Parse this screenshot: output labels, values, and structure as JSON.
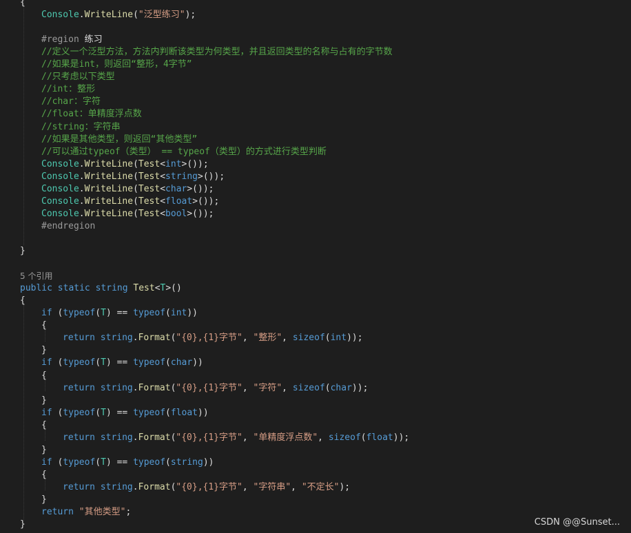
{
  "code": {
    "lines": [
      {
        "indent": 0,
        "tokens": [
          {
            "t": "{",
            "c": "pl"
          }
        ]
      },
      {
        "indent": 1,
        "tokens": [
          {
            "t": "Console",
            "c": "ty"
          },
          {
            "t": ".",
            "c": "pl"
          },
          {
            "t": "WriteLine",
            "c": "fn"
          },
          {
            "t": "(",
            "c": "pl"
          },
          {
            "t": "\"泛型练习\"",
            "c": "str"
          },
          {
            "t": ");",
            "c": "pl"
          }
        ]
      },
      {
        "indent": 0,
        "tokens": []
      },
      {
        "indent": 1,
        "tokens": [
          {
            "t": "#region ",
            "c": "pp"
          },
          {
            "t": "练习",
            "c": "pl"
          }
        ]
      },
      {
        "indent": 1,
        "tokens": [
          {
            "t": "//定义一个泛型方法，方法内判断该类型为何类型，并且返回类型的名称与占有的字节数",
            "c": "cm"
          }
        ]
      },
      {
        "indent": 1,
        "tokens": [
          {
            "t": "//如果是int，则返回“整形，4字节”",
            "c": "cm"
          }
        ]
      },
      {
        "indent": 1,
        "tokens": [
          {
            "t": "//只考虑以下类型",
            "c": "cm"
          }
        ]
      },
      {
        "indent": 1,
        "tokens": [
          {
            "t": "//int：整形",
            "c": "cm"
          }
        ]
      },
      {
        "indent": 1,
        "tokens": [
          {
            "t": "//char：字符",
            "c": "cm"
          }
        ]
      },
      {
        "indent": 1,
        "tokens": [
          {
            "t": "//float：单精度浮点数",
            "c": "cm"
          }
        ]
      },
      {
        "indent": 1,
        "tokens": [
          {
            "t": "//string：字符串",
            "c": "cm"
          }
        ]
      },
      {
        "indent": 1,
        "tokens": [
          {
            "t": "//如果是其他类型，则返回“其他类型”",
            "c": "cm"
          }
        ]
      },
      {
        "indent": 1,
        "tokens": [
          {
            "t": "//可以通过typeof（类型） == typeof（类型）的方式进行类型判断",
            "c": "cm"
          }
        ]
      },
      {
        "indent": 1,
        "tokens": [
          {
            "t": "Console",
            "c": "ty"
          },
          {
            "t": ".",
            "c": "pl"
          },
          {
            "t": "WriteLine",
            "c": "fn"
          },
          {
            "t": "(",
            "c": "pl"
          },
          {
            "t": "Test",
            "c": "fn"
          },
          {
            "t": "<",
            "c": "pl"
          },
          {
            "t": "int",
            "c": "kw"
          },
          {
            "t": ">());",
            "c": "pl"
          }
        ]
      },
      {
        "indent": 1,
        "tokens": [
          {
            "t": "Console",
            "c": "ty"
          },
          {
            "t": ".",
            "c": "pl"
          },
          {
            "t": "WriteLine",
            "c": "fn"
          },
          {
            "t": "(",
            "c": "pl"
          },
          {
            "t": "Test",
            "c": "fn"
          },
          {
            "t": "<",
            "c": "pl"
          },
          {
            "t": "string",
            "c": "kw"
          },
          {
            "t": ">());",
            "c": "pl"
          }
        ]
      },
      {
        "indent": 1,
        "tokens": [
          {
            "t": "Console",
            "c": "ty"
          },
          {
            "t": ".",
            "c": "pl"
          },
          {
            "t": "WriteLine",
            "c": "fn"
          },
          {
            "t": "(",
            "c": "pl"
          },
          {
            "t": "Test",
            "c": "fn"
          },
          {
            "t": "<",
            "c": "pl"
          },
          {
            "t": "char",
            "c": "kw"
          },
          {
            "t": ">());",
            "c": "pl"
          }
        ]
      },
      {
        "indent": 1,
        "tokens": [
          {
            "t": "Console",
            "c": "ty"
          },
          {
            "t": ".",
            "c": "pl"
          },
          {
            "t": "WriteLine",
            "c": "fn"
          },
          {
            "t": "(",
            "c": "pl"
          },
          {
            "t": "Test",
            "c": "fn"
          },
          {
            "t": "<",
            "c": "pl"
          },
          {
            "t": "float",
            "c": "kw"
          },
          {
            "t": ">());",
            "c": "pl"
          }
        ]
      },
      {
        "indent": 1,
        "tokens": [
          {
            "t": "Console",
            "c": "ty"
          },
          {
            "t": ".",
            "c": "pl"
          },
          {
            "t": "WriteLine",
            "c": "fn"
          },
          {
            "t": "(",
            "c": "pl"
          },
          {
            "t": "Test",
            "c": "fn"
          },
          {
            "t": "<",
            "c": "pl"
          },
          {
            "t": "bool",
            "c": "kw"
          },
          {
            "t": ">());",
            "c": "pl"
          }
        ]
      },
      {
        "indent": 1,
        "tokens": [
          {
            "t": "#endregion",
            "c": "pp"
          }
        ]
      },
      {
        "indent": 0,
        "tokens": []
      },
      {
        "indent": 0,
        "tokens": [
          {
            "t": "}",
            "c": "pl"
          }
        ]
      },
      {
        "indent": 0,
        "tokens": []
      },
      {
        "indent": 0,
        "tokens": [
          {
            "t": "5 个引用",
            "c": "codelens"
          }
        ]
      },
      {
        "indent": 0,
        "tokens": [
          {
            "t": "public",
            "c": "kw"
          },
          {
            "t": " ",
            "c": "pl"
          },
          {
            "t": "static",
            "c": "kw"
          },
          {
            "t": " ",
            "c": "pl"
          },
          {
            "t": "string",
            "c": "kw"
          },
          {
            "t": " ",
            "c": "pl"
          },
          {
            "t": "Test",
            "c": "fn"
          },
          {
            "t": "<",
            "c": "pl"
          },
          {
            "t": "T",
            "c": "ty"
          },
          {
            "t": ">()",
            "c": "pl"
          }
        ]
      },
      {
        "indent": 0,
        "tokens": [
          {
            "t": "{",
            "c": "pl"
          }
        ]
      },
      {
        "indent": 1,
        "tokens": [
          {
            "t": "if",
            "c": "kw"
          },
          {
            "t": " (",
            "c": "pl"
          },
          {
            "t": "typeof",
            "c": "kw"
          },
          {
            "t": "(",
            "c": "pl"
          },
          {
            "t": "T",
            "c": "ty"
          },
          {
            "t": ") == ",
            "c": "pl"
          },
          {
            "t": "typeof",
            "c": "kw"
          },
          {
            "t": "(",
            "c": "pl"
          },
          {
            "t": "int",
            "c": "kw"
          },
          {
            "t": "))",
            "c": "pl"
          }
        ]
      },
      {
        "indent": 1,
        "tokens": [
          {
            "t": "{",
            "c": "pl"
          }
        ]
      },
      {
        "indent": 2,
        "tokens": [
          {
            "t": "return",
            "c": "kw"
          },
          {
            "t": " ",
            "c": "pl"
          },
          {
            "t": "string",
            "c": "kw"
          },
          {
            "t": ".",
            "c": "pl"
          },
          {
            "t": "Format",
            "c": "fn"
          },
          {
            "t": "(",
            "c": "pl"
          },
          {
            "t": "\"{0},{1}字节\"",
            "c": "str"
          },
          {
            "t": ", ",
            "c": "pl"
          },
          {
            "t": "\"整形\"",
            "c": "str"
          },
          {
            "t": ", ",
            "c": "pl"
          },
          {
            "t": "sizeof",
            "c": "kw"
          },
          {
            "t": "(",
            "c": "pl"
          },
          {
            "t": "int",
            "c": "kw"
          },
          {
            "t": "));",
            "c": "pl"
          }
        ]
      },
      {
        "indent": 1,
        "tokens": [
          {
            "t": "}",
            "c": "pl"
          }
        ]
      },
      {
        "indent": 1,
        "tokens": [
          {
            "t": "if",
            "c": "kw"
          },
          {
            "t": " (",
            "c": "pl"
          },
          {
            "t": "typeof",
            "c": "kw"
          },
          {
            "t": "(",
            "c": "pl"
          },
          {
            "t": "T",
            "c": "ty"
          },
          {
            "t": ") == ",
            "c": "pl"
          },
          {
            "t": "typeof",
            "c": "kw"
          },
          {
            "t": "(",
            "c": "pl"
          },
          {
            "t": "char",
            "c": "kw"
          },
          {
            "t": "))",
            "c": "pl"
          }
        ]
      },
      {
        "indent": 1,
        "tokens": [
          {
            "t": "{",
            "c": "pl"
          }
        ]
      },
      {
        "indent": 2,
        "tokens": [
          {
            "t": "return",
            "c": "kw"
          },
          {
            "t": " ",
            "c": "pl"
          },
          {
            "t": "string",
            "c": "kw"
          },
          {
            "t": ".",
            "c": "pl"
          },
          {
            "t": "Format",
            "c": "fn"
          },
          {
            "t": "(",
            "c": "pl"
          },
          {
            "t": "\"{0},{1}字节\"",
            "c": "str"
          },
          {
            "t": ", ",
            "c": "pl"
          },
          {
            "t": "\"字符\"",
            "c": "str"
          },
          {
            "t": ", ",
            "c": "pl"
          },
          {
            "t": "sizeof",
            "c": "kw"
          },
          {
            "t": "(",
            "c": "pl"
          },
          {
            "t": "char",
            "c": "kw"
          },
          {
            "t": "));",
            "c": "pl"
          }
        ]
      },
      {
        "indent": 1,
        "tokens": [
          {
            "t": "}",
            "c": "pl"
          }
        ]
      },
      {
        "indent": 1,
        "tokens": [
          {
            "t": "if",
            "c": "kw"
          },
          {
            "t": " (",
            "c": "pl"
          },
          {
            "t": "typeof",
            "c": "kw"
          },
          {
            "t": "(",
            "c": "pl"
          },
          {
            "t": "T",
            "c": "ty"
          },
          {
            "t": ") == ",
            "c": "pl"
          },
          {
            "t": "typeof",
            "c": "kw"
          },
          {
            "t": "(",
            "c": "pl"
          },
          {
            "t": "float",
            "c": "kw"
          },
          {
            "t": "))",
            "c": "pl"
          }
        ]
      },
      {
        "indent": 1,
        "tokens": [
          {
            "t": "{",
            "c": "pl"
          }
        ]
      },
      {
        "indent": 2,
        "tokens": [
          {
            "t": "return",
            "c": "kw"
          },
          {
            "t": " ",
            "c": "pl"
          },
          {
            "t": "string",
            "c": "kw"
          },
          {
            "t": ".",
            "c": "pl"
          },
          {
            "t": "Format",
            "c": "fn"
          },
          {
            "t": "(",
            "c": "pl"
          },
          {
            "t": "\"{0},{1}字节\"",
            "c": "str"
          },
          {
            "t": ", ",
            "c": "pl"
          },
          {
            "t": "\"单精度浮点数\"",
            "c": "str"
          },
          {
            "t": ", ",
            "c": "pl"
          },
          {
            "t": "sizeof",
            "c": "kw"
          },
          {
            "t": "(",
            "c": "pl"
          },
          {
            "t": "float",
            "c": "kw"
          },
          {
            "t": "));",
            "c": "pl"
          }
        ]
      },
      {
        "indent": 1,
        "tokens": [
          {
            "t": "}",
            "c": "pl"
          }
        ]
      },
      {
        "indent": 1,
        "tokens": [
          {
            "t": "if",
            "c": "kw"
          },
          {
            "t": " (",
            "c": "pl"
          },
          {
            "t": "typeof",
            "c": "kw"
          },
          {
            "t": "(",
            "c": "pl"
          },
          {
            "t": "T",
            "c": "ty"
          },
          {
            "t": ") == ",
            "c": "pl"
          },
          {
            "t": "typeof",
            "c": "kw"
          },
          {
            "t": "(",
            "c": "pl"
          },
          {
            "t": "string",
            "c": "kw"
          },
          {
            "t": "))",
            "c": "pl"
          }
        ]
      },
      {
        "indent": 1,
        "tokens": [
          {
            "t": "{",
            "c": "pl"
          }
        ]
      },
      {
        "indent": 2,
        "tokens": [
          {
            "t": "return",
            "c": "kw"
          },
          {
            "t": " ",
            "c": "pl"
          },
          {
            "t": "string",
            "c": "kw"
          },
          {
            "t": ".",
            "c": "pl"
          },
          {
            "t": "Format",
            "c": "fn"
          },
          {
            "t": "(",
            "c": "pl"
          },
          {
            "t": "\"{0},{1}字节\"",
            "c": "str"
          },
          {
            "t": ", ",
            "c": "pl"
          },
          {
            "t": "\"字符串\"",
            "c": "str"
          },
          {
            "t": ", ",
            "c": "pl"
          },
          {
            "t": "\"不定长\"",
            "c": "str"
          },
          {
            "t": ");",
            "c": "pl"
          }
        ]
      },
      {
        "indent": 1,
        "tokens": [
          {
            "t": "}",
            "c": "pl"
          }
        ]
      },
      {
        "indent": 1,
        "tokens": [
          {
            "t": "return",
            "c": "kw"
          },
          {
            "t": " ",
            "c": "pl"
          },
          {
            "t": "\"其他类型\"",
            "c": "str"
          },
          {
            "t": ";",
            "c": "pl"
          }
        ]
      },
      {
        "indent": 0,
        "tokens": [
          {
            "t": "}",
            "c": "pl"
          }
        ]
      }
    ]
  },
  "watermark": "CSDN @@Sunset..."
}
